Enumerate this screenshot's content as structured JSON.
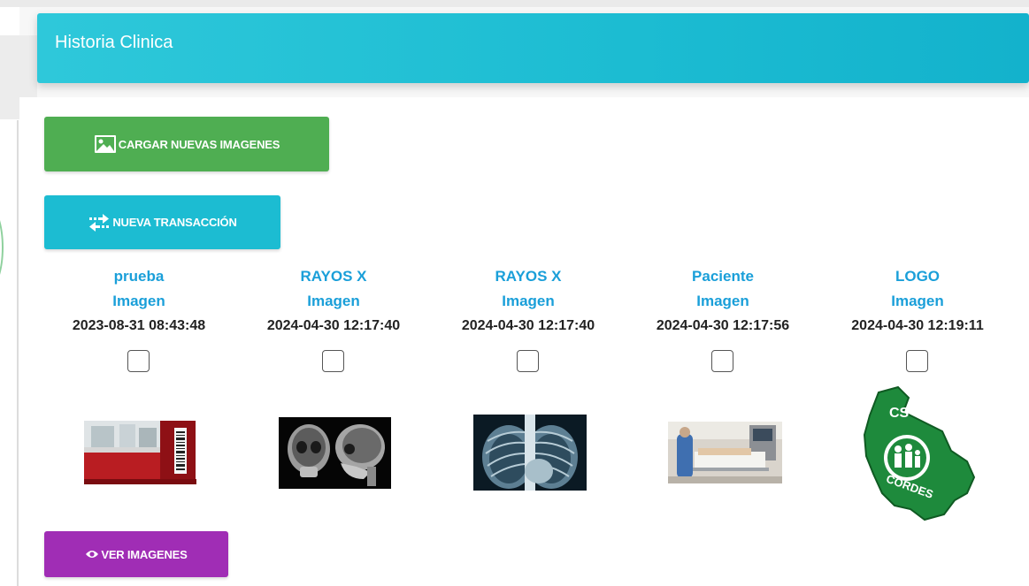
{
  "header": {
    "title": "Historia Clinica"
  },
  "buttons": {
    "upload": "CARGAR NUEVAS IMAGENES",
    "transaction": "NUEVA TRANSACCIÓN",
    "view": "VER IMAGENES"
  },
  "images": [
    {
      "name": "prueba",
      "type": "Imagen",
      "date": "2023-08-31 08:43:48",
      "checked": false
    },
    {
      "name": "RAYOS X",
      "type": "Imagen",
      "date": "2024-04-30 12:17:40",
      "checked": false
    },
    {
      "name": "RAYOS X",
      "type": "Imagen",
      "date": "2024-04-30 12:17:40",
      "checked": false
    },
    {
      "name": "Paciente",
      "type": "Imagen",
      "date": "2024-04-30 12:17:56",
      "checked": false
    },
    {
      "name": "LOGO",
      "type": "Imagen",
      "date": "2024-04-30 12:19:11",
      "checked": false
    }
  ],
  "logo_text": {
    "top": "CS",
    "bottom": "CORDES"
  },
  "colors": {
    "header": "#1cbcd2",
    "upload": "#4fae52",
    "view": "#a02db5",
    "link": "#1a9fd9"
  }
}
